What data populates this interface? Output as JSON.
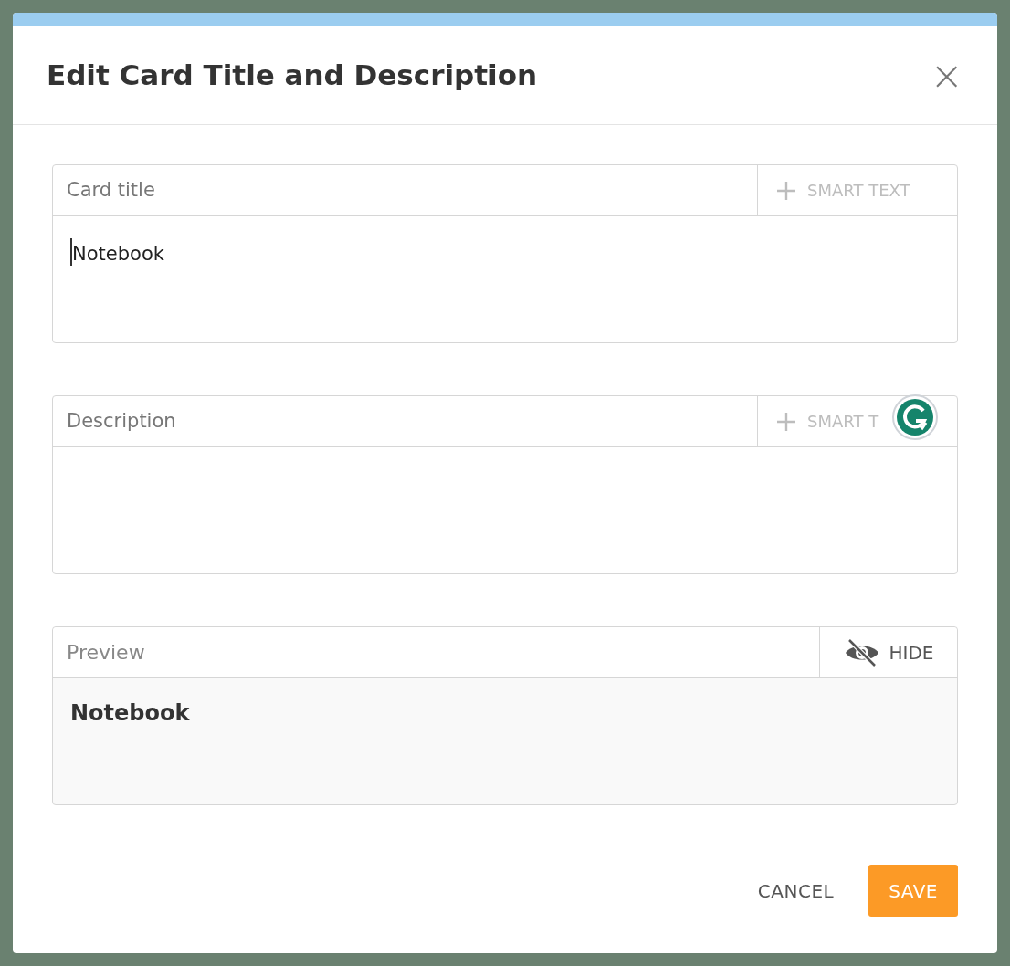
{
  "dialog": {
    "title": "Edit Card Title and Description",
    "close": "×"
  },
  "fields": [
    {
      "label": "Card title",
      "button": "SMART TEXT",
      "value": "Notebook",
      "focused": true,
      "grammar_badge": false
    },
    {
      "label": "Description",
      "button": "SMART T",
      "focused": false,
      "grammar_badge": true
    }
  ],
  "preview": {
    "label": "Preview",
    "button": "HIDE",
    "text": "Notebook"
  },
  "buttons": [
    {
      "label": "CANCEL",
      "kind": "secondary"
    },
    {
      "label": "SAVE",
      "kind": "primary"
    }
  ]
}
